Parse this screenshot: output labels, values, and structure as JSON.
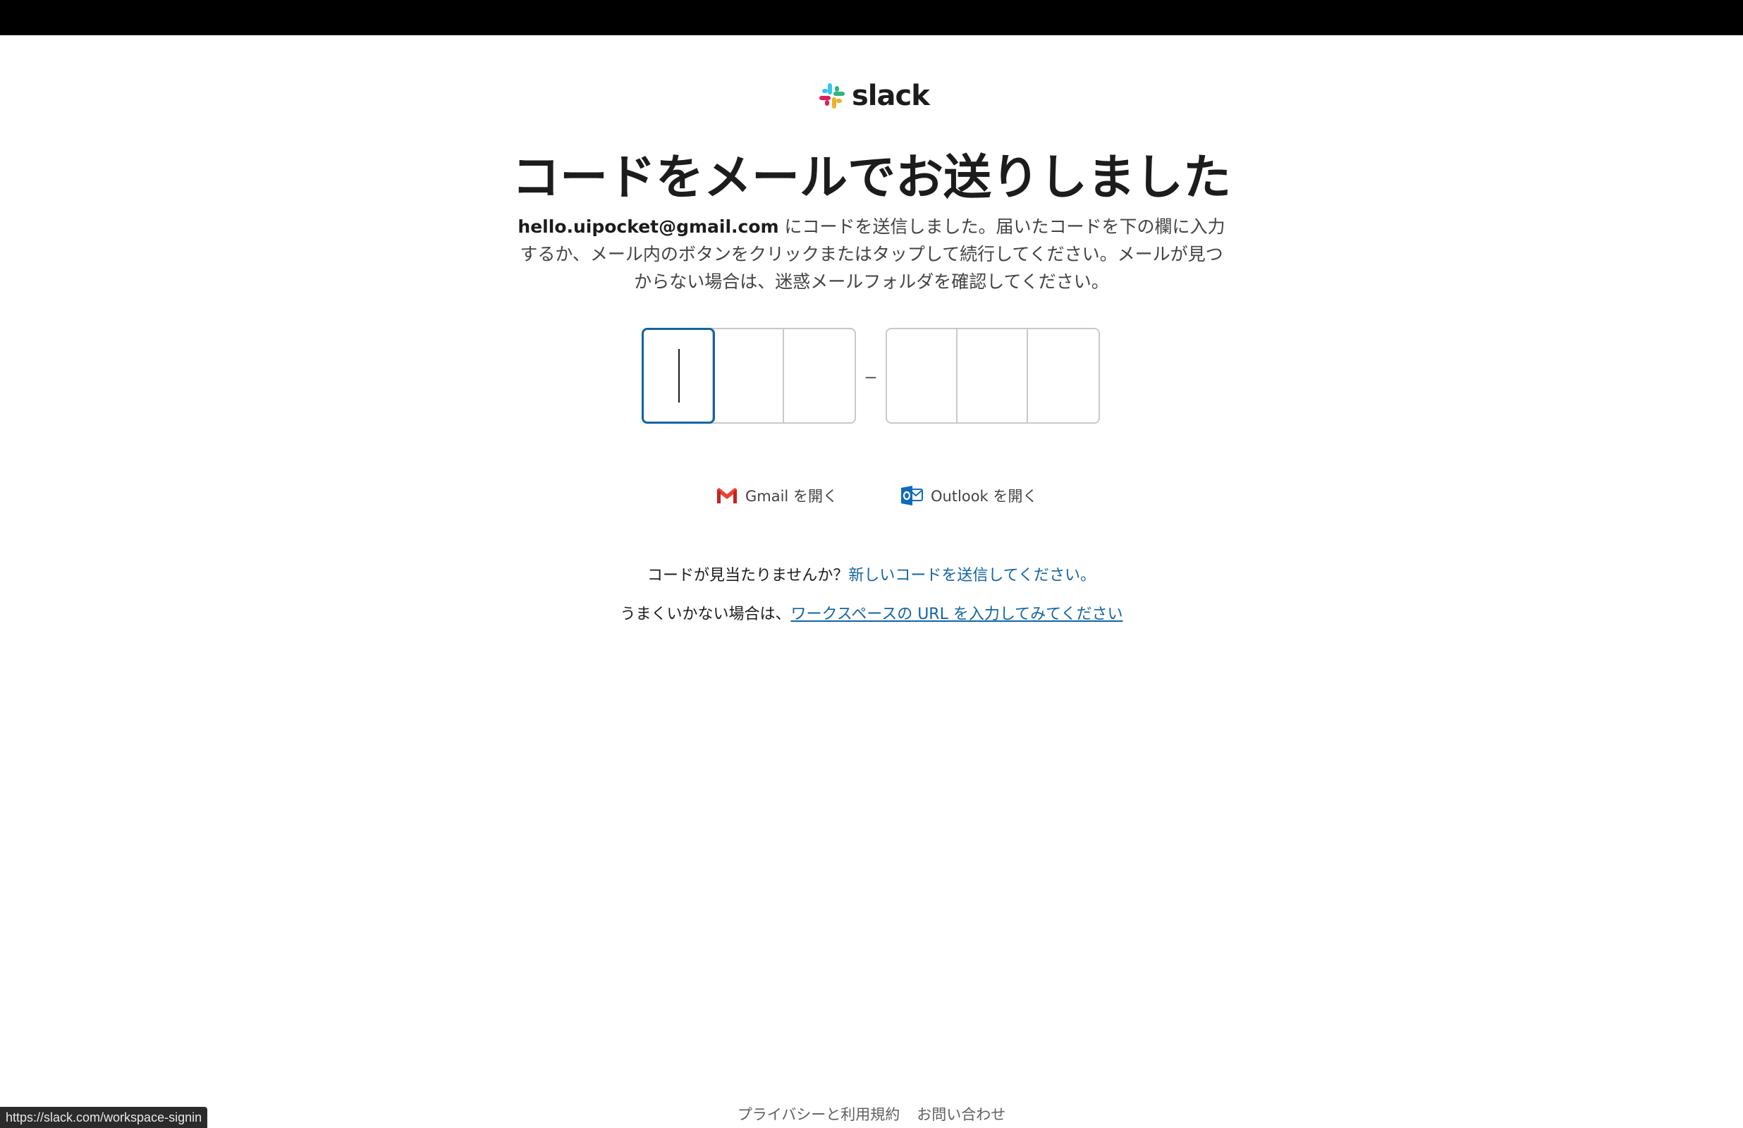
{
  "brand": {
    "name": "slack",
    "colors": {
      "blue": "#36C5F0",
      "green": "#2EB67D",
      "yellow": "#ECB22E",
      "red": "#E01E5A"
    }
  },
  "main": {
    "title": "コードをメールでお送りしました",
    "email": "hello.uipocket@gmail.com",
    "description": " にコードを送信しました。届いたコードを下の欄に入力するか、メール内のボタンをクリックまたはタップして続行してください。メールが見つからない場合は、迷惑メールフォルダを確認してください。",
    "code_separator": "–",
    "code_values": [
      "",
      "",
      "",
      "",
      "",
      ""
    ]
  },
  "mail_links": {
    "gmail": "Gmail を開く",
    "outlook": "Outlook を開く"
  },
  "help": {
    "missing_prefix": "コードが見当たりませんか？",
    "resend_link": "新しいコードを送信してください。",
    "trouble_prefix": "うまくいかない場合は、",
    "workspace_link": "ワークスペースの URL を入力してみてください"
  },
  "footer": {
    "privacy": "プライバシーと利用規約",
    "contact": "お問い合わせ"
  },
  "status_bar": {
    "url": "https://slack.com/workspace-signin"
  }
}
